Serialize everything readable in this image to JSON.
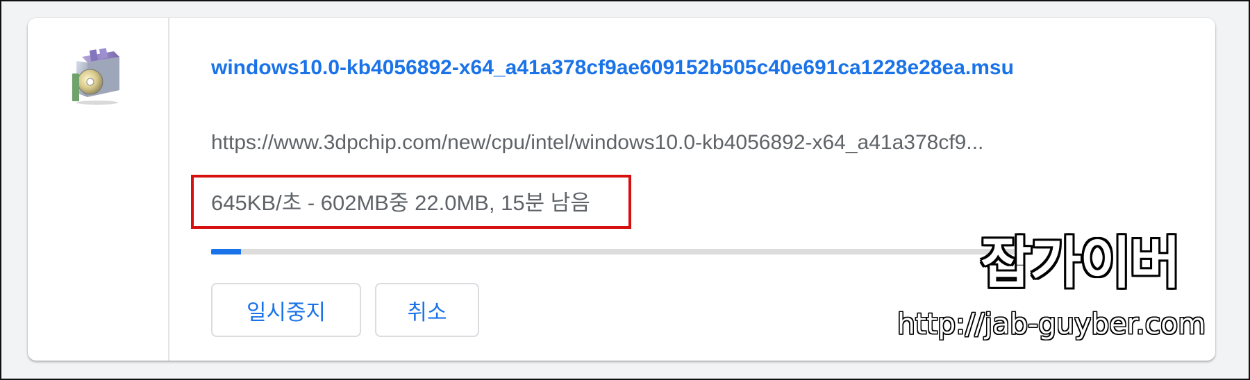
{
  "download": {
    "icon": "msu-package-icon",
    "filename": "windows10.0-kb4056892-x64_a41a378cf9ae609152b505c40e691ca1228e28ea.msu",
    "url": "https://www.3dpchip.com/new/cpu/intel/windows10.0-kb4056892-x64_a41a378cf9...",
    "status": "645KB/초 - 602MB중 22.0MB, 15분 남음",
    "progress_fraction": 0.0365,
    "accent_color": "#1a73e8",
    "pause_label": "일시중지",
    "cancel_label": "취소"
  },
  "annotation": {
    "highlight_color": "#d60f0f"
  },
  "watermark": {
    "title": "잡가이버",
    "url": "http://jab-guyber.com"
  }
}
